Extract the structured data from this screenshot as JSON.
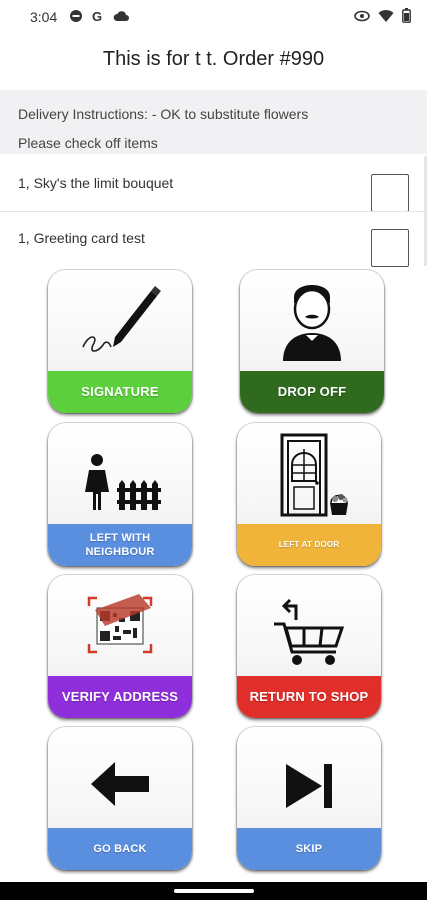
{
  "status_bar": {
    "time": "3:04",
    "left_icons": [
      "do-not-disturb-icon",
      "google-icon",
      "cloud-icon"
    ],
    "right_icons": [
      "eye-icon",
      "wifi-icon",
      "battery-icon"
    ]
  },
  "header": {
    "title": "This is for t t. Order #990"
  },
  "instructions": {
    "delivery": "Delivery Instructions:  - OK to substitute flowers",
    "check_prompt": "Please check off items"
  },
  "items": [
    {
      "label": "1, Sky's the limit bouquet",
      "checked": false
    },
    {
      "label": "1, Greeting card test",
      "checked": false
    }
  ],
  "actions": [
    {
      "label": "SIGNATURE",
      "color": "#5ccf3c",
      "icon": "pen-signature-icon"
    },
    {
      "label": "DROP OFF",
      "color": "#2f6a1f",
      "icon": "butler-icon"
    },
    {
      "label": "LEFT WITH\nNEIGHBOUR",
      "color": "#5a8fe0",
      "icon": "person-fence-icon"
    },
    {
      "label": "LEFT AT DOOR",
      "color": "#f0b43a",
      "icon": "door-basket-icon"
    },
    {
      "label": "VERIFY ADDRESS",
      "color": "#8f2fdc",
      "icon": "qr-scan-icon"
    },
    {
      "label": "RETURN TO SHOP",
      "color": "#e02e2a",
      "icon": "return-cart-icon"
    },
    {
      "label": "GO BACK",
      "color": "#5a8fe0",
      "icon": "arrow-left-icon"
    },
    {
      "label": "SKIP",
      "color": "#5a8fe0",
      "icon": "skip-next-icon"
    }
  ]
}
